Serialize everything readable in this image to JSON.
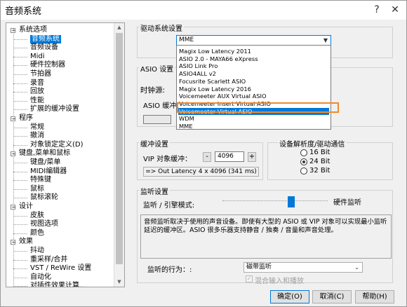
{
  "window": {
    "title": "音频系统",
    "help_btn": "?",
    "close_btn": "✕"
  },
  "tree": {
    "items": [
      {
        "label": "系统选项"
      },
      {
        "label": "音频系统",
        "selected": true
      },
      {
        "label": "音频设备"
      },
      {
        "label": "Midi"
      },
      {
        "label": "硬件控制器"
      },
      {
        "label": "节拍器"
      },
      {
        "label": "录音"
      },
      {
        "label": "回放"
      },
      {
        "label": "性能"
      },
      {
        "label": "扩展的缓冲设置"
      },
      {
        "label": "程序"
      },
      {
        "label": "常规"
      },
      {
        "label": "撤消"
      },
      {
        "label": "对象锁定定义(D)"
      },
      {
        "label": "键盘,菜单和鼠标"
      },
      {
        "label": "键盘/菜单"
      },
      {
        "label": "MIDI编辑器"
      },
      {
        "label": "特殊键"
      },
      {
        "label": "鼠标"
      },
      {
        "label": "鼠标滚轮"
      },
      {
        "label": "设计"
      },
      {
        "label": "皮肤"
      },
      {
        "label": "视图选项"
      },
      {
        "label": "颜色"
      },
      {
        "label": "效果"
      },
      {
        "label": "抖动"
      },
      {
        "label": "重采样/合并"
      },
      {
        "label": "VST / ReWire 设置"
      },
      {
        "label": "自动化"
      },
      {
        "label": "对插件效果计算..."
      }
    ]
  },
  "driver": {
    "group_label": "驱动系统设置",
    "selected": "MME",
    "options": [
      "Magix Low Latency 2011",
      "ASIO 2.0 - MAYA66 eXpress",
      "ASIO Link Pro",
      "ASIO4ALL v2",
      "Focusrite Scarlett ASIO",
      "Magix Low Latency 2016",
      "Voicemeeter AUX Virtual ASIO",
      "Voicemeeter Insert Virtual ASIO",
      "Voicemeeter Virtual ASIO",
      "WDM",
      "MME"
    ],
    "highlighted": "Voicemeeter Virtual ASIO"
  },
  "asio": {
    "group_label": "ASIO 设置",
    "clock_label": "时钟源:",
    "buffer_label": "ASIO 缓冲"
  },
  "buffer": {
    "group_label": "缓冲设置",
    "vip_label": "VIP 对象缓冲：",
    "minus": "-",
    "value": "4096",
    "plus": "+",
    "latency": "=> Out Latency 4 x 4096 (341 ms)"
  },
  "resolution": {
    "group_label": "设备解析度/驱动通信",
    "options": [
      {
        "label": "16 Bit",
        "checked": false
      },
      {
        "label": "24 Bit",
        "checked": true
      },
      {
        "label": "32 Bit",
        "checked": false
      }
    ]
  },
  "monitor": {
    "group_label": "监听设置",
    "mode_label": "监听 / 引擎模式:",
    "right_label": "硬件监听",
    "slider_position": 0.65,
    "description": "音频监听取决于使用的声音设备。即使有大型的 ASIO 或 VIP 对象可以实现最小监听延迟的缓冲区。ASIO 很多乐器支持静音 / 独奏 / 音量和声音处理。",
    "behavior_label": "监听的行为：:",
    "behavior_value": "磁带监听",
    "mix_label": "混合输入和播放"
  },
  "buttons": {
    "ok": "确定(O)",
    "cancel": "取消(C)",
    "help": "帮助(H)"
  }
}
